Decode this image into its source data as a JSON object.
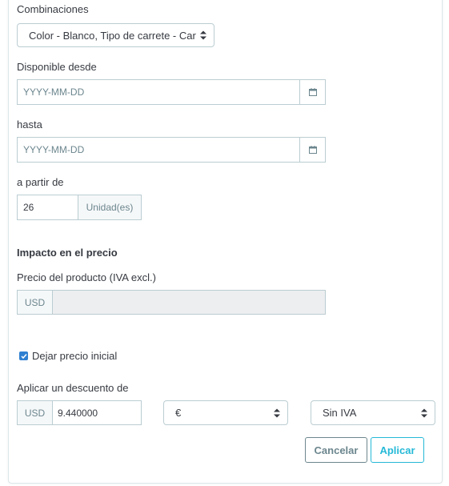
{
  "combinations": {
    "label": "Combinaciones",
    "selected": "Color - Blanco, Tipo de carrete - Car"
  },
  "available_from": {
    "label": "Disponible desde",
    "placeholder": "YYYY-MM-DD"
  },
  "until": {
    "label": "hasta",
    "placeholder": "YYYY-MM-DD"
  },
  "from_quantity": {
    "label": "a partir de",
    "value": "26",
    "unit": "Unidad(es)"
  },
  "price_impact": {
    "heading": "Impacto en el precio",
    "product_price_label": "Precio del producto (IVA excl.)",
    "currency": "USD",
    "value": ""
  },
  "keep_initial_price": {
    "label": "Dejar precio inicial",
    "checked": true
  },
  "discount": {
    "label": "Aplicar un descuento de",
    "currency": "USD",
    "value": "9.440000",
    "type_selected": "€",
    "tax_selected": "Sin IVA"
  },
  "buttons": {
    "cancel": "Cancelar",
    "apply": "Aplicar"
  },
  "colors": {
    "primary": "#25b9d7",
    "checkbox": "#2f80d1",
    "border": "#bbcdd2",
    "disabled_bg": "#eceeef"
  },
  "icons": {
    "calendar": "calendar-icon",
    "select_caret": "updown-caret-icon",
    "checkbox": "checkmark-icon"
  }
}
